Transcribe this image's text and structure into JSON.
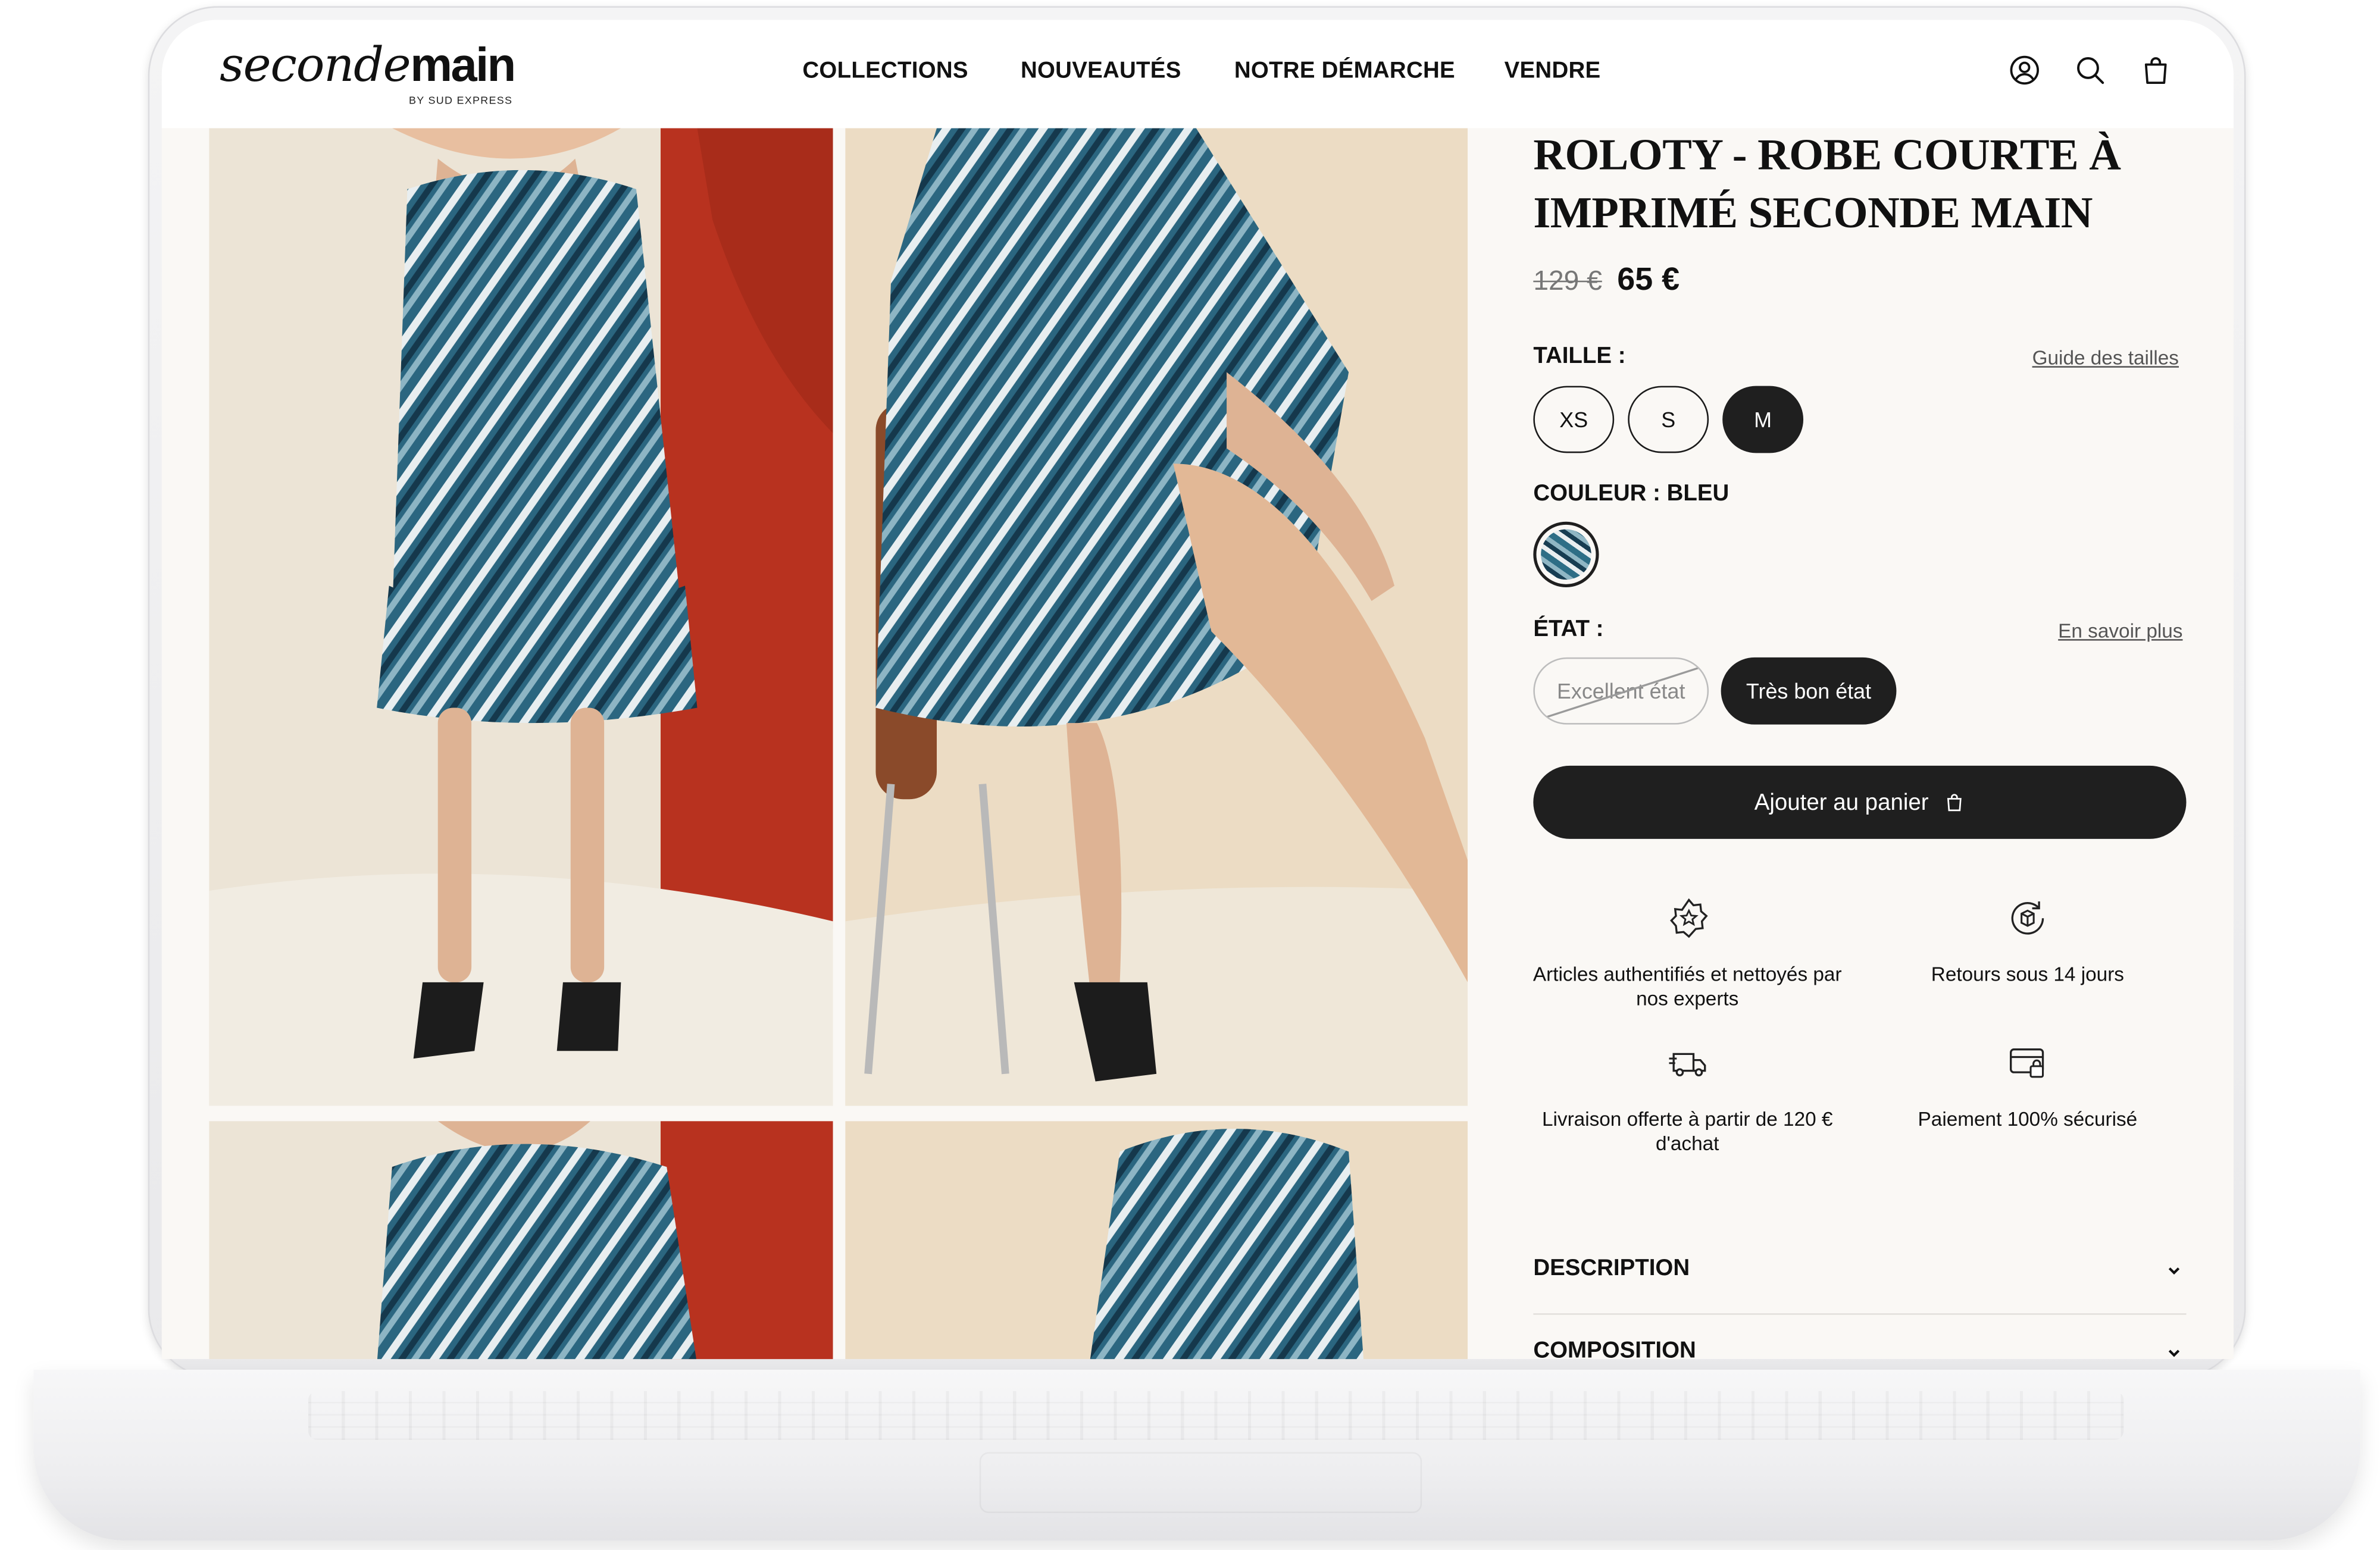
{
  "brand": {
    "logo_script": "seconde",
    "logo_bold": "main",
    "logo_tagline": "BY SUD EXPRESS"
  },
  "nav": {
    "items": [
      "COLLECTIONS",
      "NOUVEAUTÉS",
      "NOTRE DÉMARCHE",
      "VENDRE"
    ]
  },
  "header_icons": [
    "account-icon",
    "search-icon",
    "shopping-bag-icon"
  ],
  "product": {
    "title": "ROLOTY - ROBE COURTE À IMPRIMÉ SECONDE MAIN",
    "old_price": "129 €",
    "price": "65 €",
    "size": {
      "label": "TAILLE :",
      "guide_link": "Guide des tailles",
      "options": [
        "XS",
        "S",
        "M"
      ],
      "selected": "M"
    },
    "color": {
      "label": "COULEUR : BLEU",
      "selected": "BLEU"
    },
    "condition": {
      "label": "ÉTAT :",
      "info_link": "En savoir plus",
      "options": [
        {
          "label": "Excellent état",
          "available": false
        },
        {
          "label": "Très bon état",
          "available": true
        }
      ],
      "selected": "Très bon état"
    },
    "add_to_cart": "Ajouter au panier"
  },
  "features": [
    {
      "icon": "badge-star-icon",
      "text": "Articles authentifiés et nettoyés par nos experts"
    },
    {
      "icon": "returns-box-icon",
      "text": "Retours sous 14 jours"
    },
    {
      "icon": "delivery-truck-icon",
      "text": "Livraison offerte à partir de 120 € d'achat"
    },
    {
      "icon": "secure-card-icon",
      "text": "Paiement 100% sécurisé"
    }
  ],
  "accordion": [
    {
      "title": "DESCRIPTION",
      "icon": "chevron-down-icon"
    },
    {
      "title": "COMPOSITION",
      "icon": "chevron-down-icon"
    }
  ],
  "colors": {
    "accent_dark": "#1f1f1f",
    "page_bg": "#faf8f5",
    "dress_blue": "#2e6e86",
    "wall_red": "#b8321f"
  }
}
